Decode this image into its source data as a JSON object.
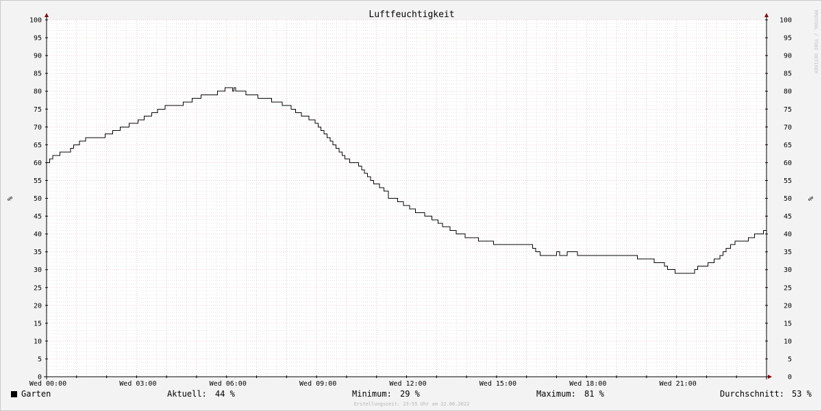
{
  "chart_data": {
    "type": "line",
    "title": "Luftfeuchtigkeit",
    "ylabel": "%",
    "ylim": [
      0,
      100
    ],
    "y_ticks": [
      0,
      5,
      10,
      15,
      20,
      25,
      30,
      35,
      40,
      45,
      50,
      55,
      60,
      65,
      70,
      75,
      80,
      85,
      90,
      95,
      100
    ],
    "x_tick_labels": [
      "Wed 00:00",
      "Wed 03:00",
      "Wed 06:00",
      "Wed 09:00",
      "Wed 12:00",
      "Wed 15:00",
      "Wed 18:00",
      "Wed 21:00"
    ],
    "x_tick_hours": [
      0,
      3,
      6,
      9,
      12,
      15,
      18,
      21
    ],
    "xlim_hours": [
      0,
      24
    ],
    "grid": true,
    "series": [
      {
        "name": "Garten",
        "color": "#000000",
        "x_hours": [
          0,
          0.1,
          0.2,
          0.35,
          0.45,
          0.6,
          0.8,
          0.9,
          1.1,
          1.3,
          1.85,
          1.95,
          2.2,
          2.45,
          2.75,
          3.05,
          3.25,
          3.5,
          3.7,
          3.95,
          4.25,
          4.55,
          4.85,
          5.15,
          5.4,
          5.7,
          5.95,
          6.1,
          6.2,
          6.25,
          6.3,
          6.4,
          6.65,
          7.05,
          7.5,
          7.85,
          8.15,
          8.3,
          8.5,
          8.75,
          8.95,
          9.05,
          9.15,
          9.25,
          9.35,
          9.45,
          9.55,
          9.65,
          9.75,
          9.85,
          9.95,
          10.1,
          10.25,
          10.4,
          10.5,
          10.6,
          10.7,
          10.8,
          10.9,
          11.1,
          11.25,
          11.4,
          11.5,
          11.7,
          11.9,
          12.1,
          12.3,
          12.6,
          12.85,
          13.05,
          13.2,
          13.45,
          13.65,
          13.95,
          14.4,
          14.9,
          16.2,
          16.3,
          16.45,
          16.55,
          17.0,
          17.1,
          17.35,
          17.7,
          18.2,
          19.7,
          20.25,
          20.6,
          20.7,
          20.95,
          21.5,
          21.6,
          21.7,
          22.05,
          22.25,
          22.45,
          22.55,
          22.65,
          22.8,
          22.95,
          23.4,
          23.6,
          23.9
        ],
        "values": [
          60,
          61,
          62,
          62,
          63,
          63,
          64,
          65,
          66,
          67,
          67,
          68,
          69,
          70,
          71,
          72,
          73,
          74,
          75,
          76,
          76,
          77,
          78,
          79,
          79,
          80,
          81,
          81,
          80,
          81,
          80,
          80,
          79,
          78,
          77,
          76,
          75,
          74,
          73,
          72,
          71,
          70,
          69,
          68,
          67,
          66,
          65,
          64,
          63,
          62,
          61,
          60,
          60,
          59,
          58,
          57,
          56,
          55,
          54,
          53,
          52,
          50,
          50,
          49,
          48,
          47,
          46,
          45,
          44,
          43,
          42,
          41,
          40,
          39,
          38,
          37,
          36,
          35,
          34,
          34,
          35,
          34,
          35,
          34,
          34,
          33,
          32,
          31,
          30,
          29,
          29,
          30,
          31,
          32,
          33,
          34,
          35,
          36,
          37,
          38,
          39,
          40,
          41,
          42,
          43,
          44
        ]
      }
    ]
  },
  "legend": {
    "series_name": "Garten",
    "current_label": "Aktuell:",
    "current_value": "44 %",
    "min_label": "Minimum:",
    "min_value": "29 %",
    "max_label": "Maximum:",
    "max_value": "81 %",
    "avg_label": "Durchschnitt:",
    "avg_value": "53 %"
  },
  "watermark": "RRDTOOL / TOBI OETIKER",
  "footer": "Erstellungszeit: 23:55 Uhr am 22.06.2022",
  "colors": {
    "major_grid": "#e8a6b4",
    "minor_grid": "#c9c9c9",
    "axis": "#000000",
    "arrow": "#8b0000"
  }
}
